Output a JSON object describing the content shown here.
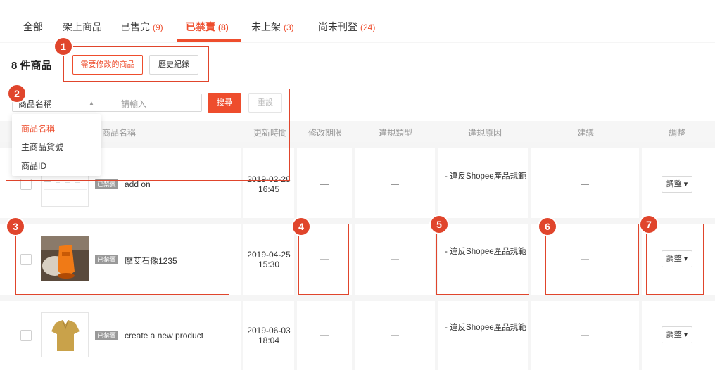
{
  "tabs": [
    {
      "label": "全部",
      "count": ""
    },
    {
      "label": "架上商品",
      "count": ""
    },
    {
      "label": "已售完",
      "count": "(9)"
    },
    {
      "label": "已禁賣",
      "count": "(8)"
    },
    {
      "label": "未上架",
      "count": "(3)"
    },
    {
      "label": "尚未刊登",
      "count": "(24)"
    }
  ],
  "count_label": "8 件商品",
  "buttons": {
    "need_modify": "需要修改的商品",
    "history": "歷史紀錄",
    "search": "搜尋",
    "reset": "重設"
  },
  "search": {
    "field_value": "商品名稱",
    "keyword_placeholder": "請輸入",
    "dropdown_options": [
      "商品名稱",
      "主商品貨號",
      "商品ID"
    ]
  },
  "table": {
    "headers": [
      "商品名稱",
      "更新時間",
      "修改期限",
      "違規類型",
      "違規原因",
      "建議",
      "調整"
    ],
    "rows": [
      {
        "badge": "已禁賣",
        "name": "add on",
        "date": "2019-02-28",
        "time": "16:45",
        "deadline": "—",
        "type": "—",
        "reason": "- 違反Shopee產品規範",
        "suggestion": "—",
        "adjust": "調整 ▾"
      },
      {
        "badge": "已禁賣",
        "name": "摩艾石像1235",
        "date": "2019-04-25",
        "time": "15:30",
        "deadline": "—",
        "type": "—",
        "reason": "- 違反Shopee產品規範",
        "suggestion": "—",
        "adjust": "調整 ▾"
      },
      {
        "badge": "已禁賣",
        "name": "create a new product",
        "date": "2019-06-03",
        "time": "18:04",
        "deadline": "—",
        "type": "—",
        "reason": "- 違反Shopee產品規範",
        "suggestion": "—",
        "adjust": "調整 ▾"
      }
    ]
  },
  "markers": [
    "1",
    "2",
    "3",
    "4",
    "5",
    "6",
    "7"
  ],
  "colors": {
    "accent": "#ee4d2d",
    "annotation": "#e0452c",
    "badge": "#999999"
  }
}
